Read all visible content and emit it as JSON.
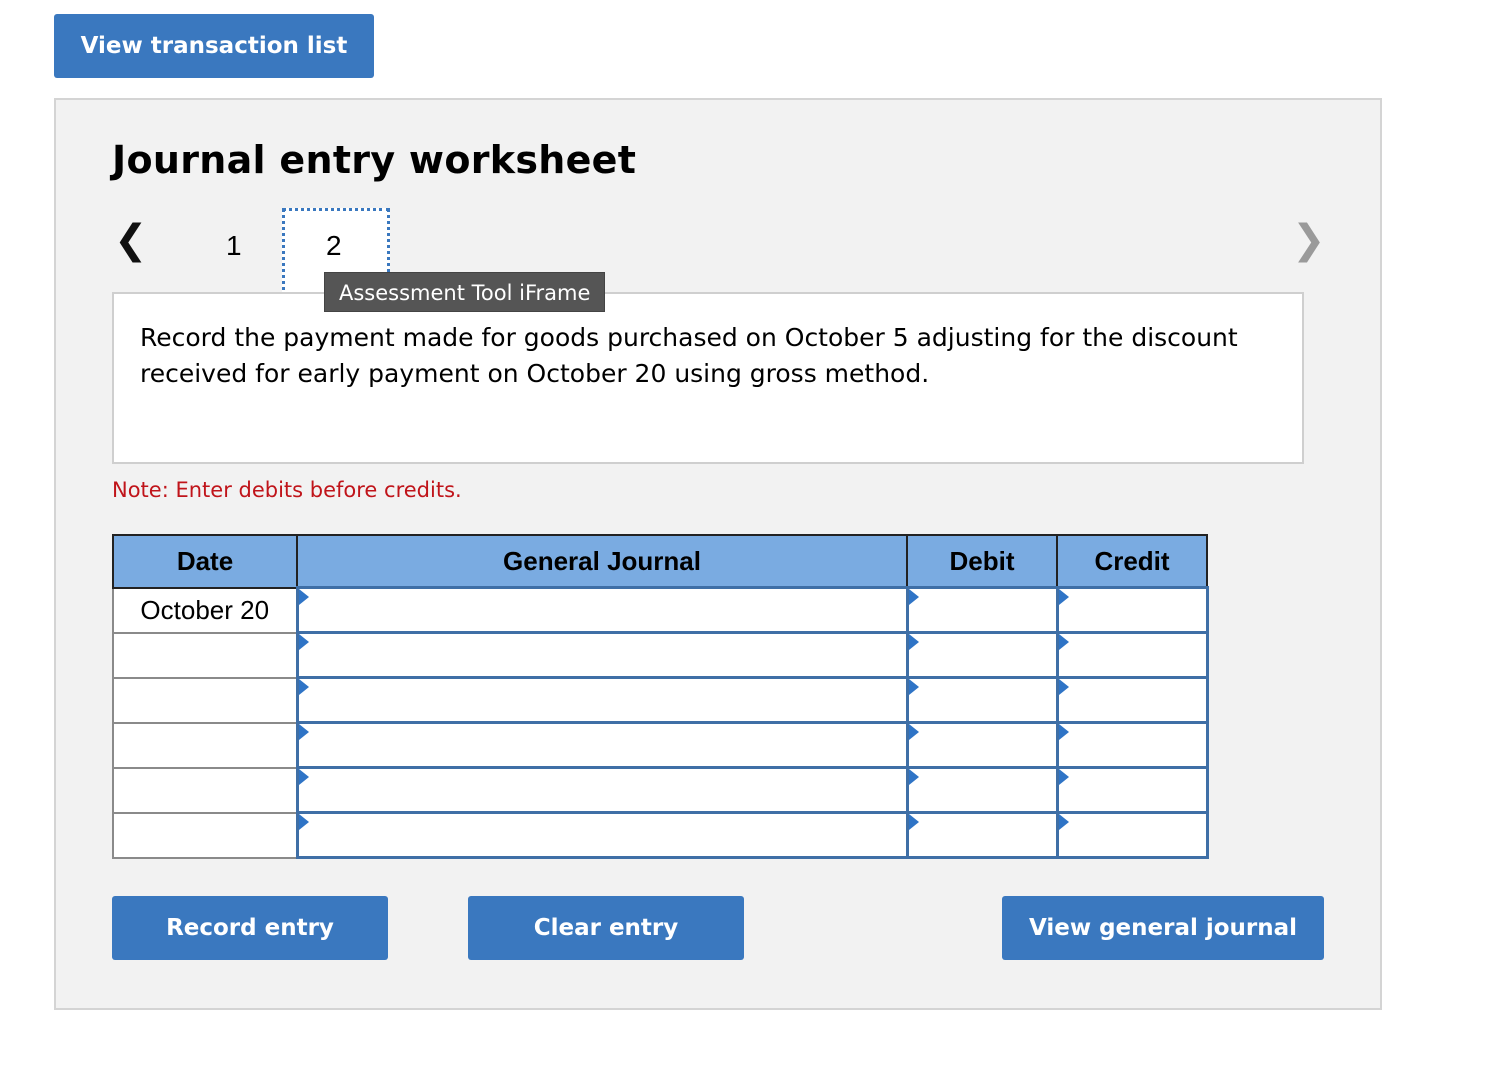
{
  "top_button": {
    "label": "View transaction list"
  },
  "worksheet": {
    "title": "Journal entry worksheet",
    "pager": {
      "prev_icon": "chevron-left-icon",
      "next_icon": "chevron-right-icon",
      "pages": [
        "1",
        "2"
      ],
      "current_page": "2"
    },
    "tooltip": "Assessment Tool iFrame",
    "instruction": "Record the payment made for goods purchased on October 5 adjusting for the discount received for early payment on October 20 using gross method.",
    "note": "Note: Enter debits before credits.",
    "table": {
      "headers": {
        "date": "Date",
        "general_journal": "General Journal",
        "debit": "Debit",
        "credit": "Credit"
      },
      "rows": [
        {
          "date": "October 20",
          "account": "",
          "debit": "",
          "credit": ""
        },
        {
          "date": "",
          "account": "",
          "debit": "",
          "credit": ""
        },
        {
          "date": "",
          "account": "",
          "debit": "",
          "credit": ""
        },
        {
          "date": "",
          "account": "",
          "debit": "",
          "credit": ""
        },
        {
          "date": "",
          "account": "",
          "debit": "",
          "credit": ""
        },
        {
          "date": "",
          "account": "",
          "debit": "",
          "credit": ""
        }
      ]
    },
    "buttons": {
      "record": "Record entry",
      "clear": "Clear entry",
      "view_general_journal": "View general journal"
    }
  },
  "colors": {
    "button_blue": "#3a78bf",
    "header_blue": "#7aabe1",
    "note_red": "#c0141a",
    "panel_gray": "#f2f2f2"
  }
}
